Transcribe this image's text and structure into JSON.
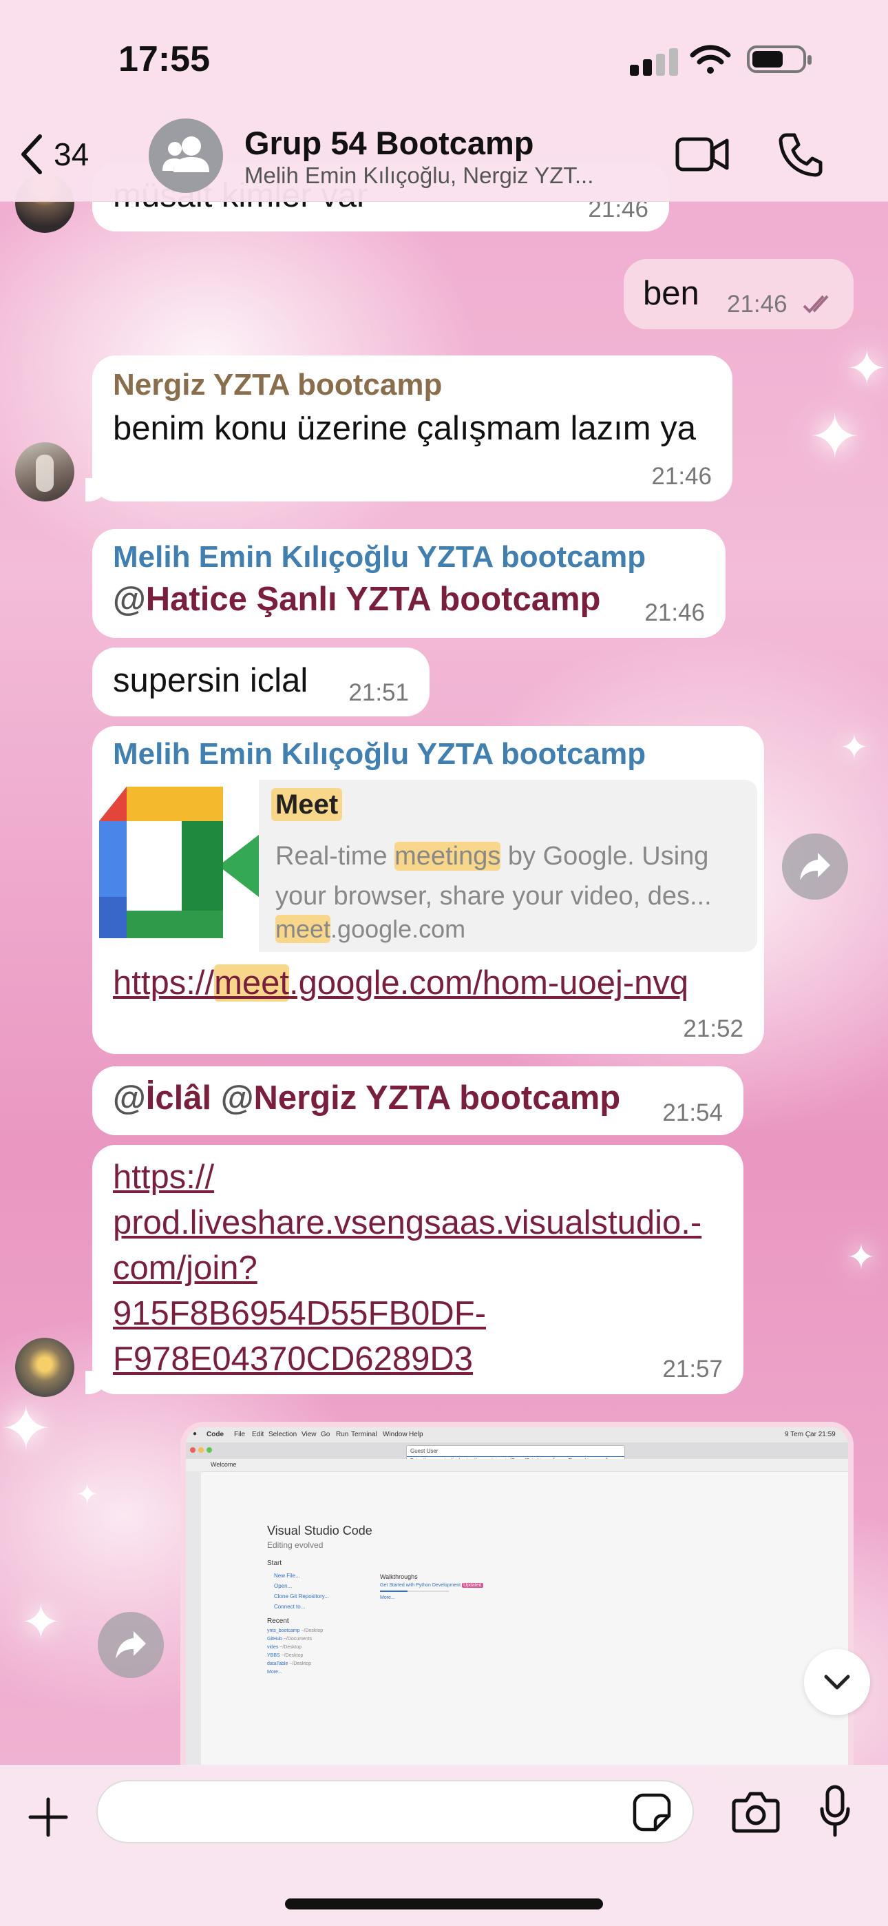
{
  "status_bar": {
    "time": "17:55"
  },
  "header": {
    "back_count": "34",
    "title": "Grup 54 Bootcamp",
    "subtitle": "Melih Emin Kılıçoğlu, Nergiz YZT..."
  },
  "messages": {
    "m0": {
      "text": "müsait kimler var",
      "time": "21:46"
    },
    "m1": {
      "text": "ben",
      "time": "21:46"
    },
    "m2": {
      "sender": "Nergiz YZTA bootcamp",
      "text": "benim konu üzerine çalışmam lazım ya",
      "time": "21:46"
    },
    "m3": {
      "sender": "Melih Emin Kılıçoğlu YZTA bootcamp",
      "mention_prefix": "@",
      "mention": "Hatice Şanlı YZTA bootcamp",
      "time": "21:46"
    },
    "m4": {
      "text": "supersin iclal",
      "time": "21:51"
    },
    "m5": {
      "sender": "Melih Emin Kılıçoğlu YZTA bootcamp",
      "preview_title": "Meet",
      "preview_desc_1": "Real-time ",
      "preview_desc_hl": "meetings",
      "preview_desc_2": " by Google. Using",
      "preview_desc_3": "your browser, share your video, des...",
      "preview_domain_hl": "meet",
      "preview_domain_rest": ".google.com",
      "link_pre": "https://",
      "link_hl": "meet",
      "link_post": ".google.com/hom-uoej-nvq",
      "time": "21:52"
    },
    "m6": {
      "at1": "@",
      "mention1": "İclâl",
      "at2": " @",
      "mention2": "Nergiz YZTA bootcamp",
      "time": "21:54"
    },
    "m7": {
      "link_lines": [
        "https://",
        "prod.liveshare.vsengsaas.visualstudio.-",
        "com/join?",
        "915F8B6954D55FB0DF-",
        "F978E04370CD6289D3"
      ],
      "time": "21:57"
    }
  },
  "screenshot_image": {
    "menubar": [
      "Code",
      "File",
      "Edit",
      "Selection",
      "View",
      "Go",
      "Run",
      "Terminal",
      "Window",
      "Help"
    ],
    "clock": "9 Tem Çar 21:59",
    "tab": "Welcome",
    "dialog_label": "Guest User",
    "dialog_hint": "Enter the name to display to other participants (Press 'Enter' to confirm or 'Escape' to cancel)",
    "app_title": "Visual Studio Code",
    "app_subtitle": "Editing evolved",
    "start_heading": "Start",
    "start_items": [
      "New File...",
      "Open...",
      "Clone Git Repository...",
      "Connect to..."
    ],
    "recent_heading": "Recent",
    "recent_items": [
      {
        "name": "ynts_bootcamp",
        "path": "~/Desktop"
      },
      {
        "name": "GitHub",
        "path": "~/Documents"
      },
      {
        "name": "vides",
        "path": "~/Desktop"
      },
      {
        "name": "YBBS",
        "path": "~/Desktop"
      },
      {
        "name": "dataTable",
        "path": "~/Desktop"
      }
    ],
    "recent_more": "More...",
    "walkthroughs_heading": "Walkthroughs",
    "walkthrough_item": "Get Started with Python Development",
    "walkthrough_badge": "Updated",
    "walkthrough_more": "More..."
  },
  "colors": {
    "sender_nergiz": "#8a6e4b",
    "sender_melih": "#3f7fb1",
    "mention": "#7a1e3c",
    "own_bubble": "#f9d8e6"
  }
}
